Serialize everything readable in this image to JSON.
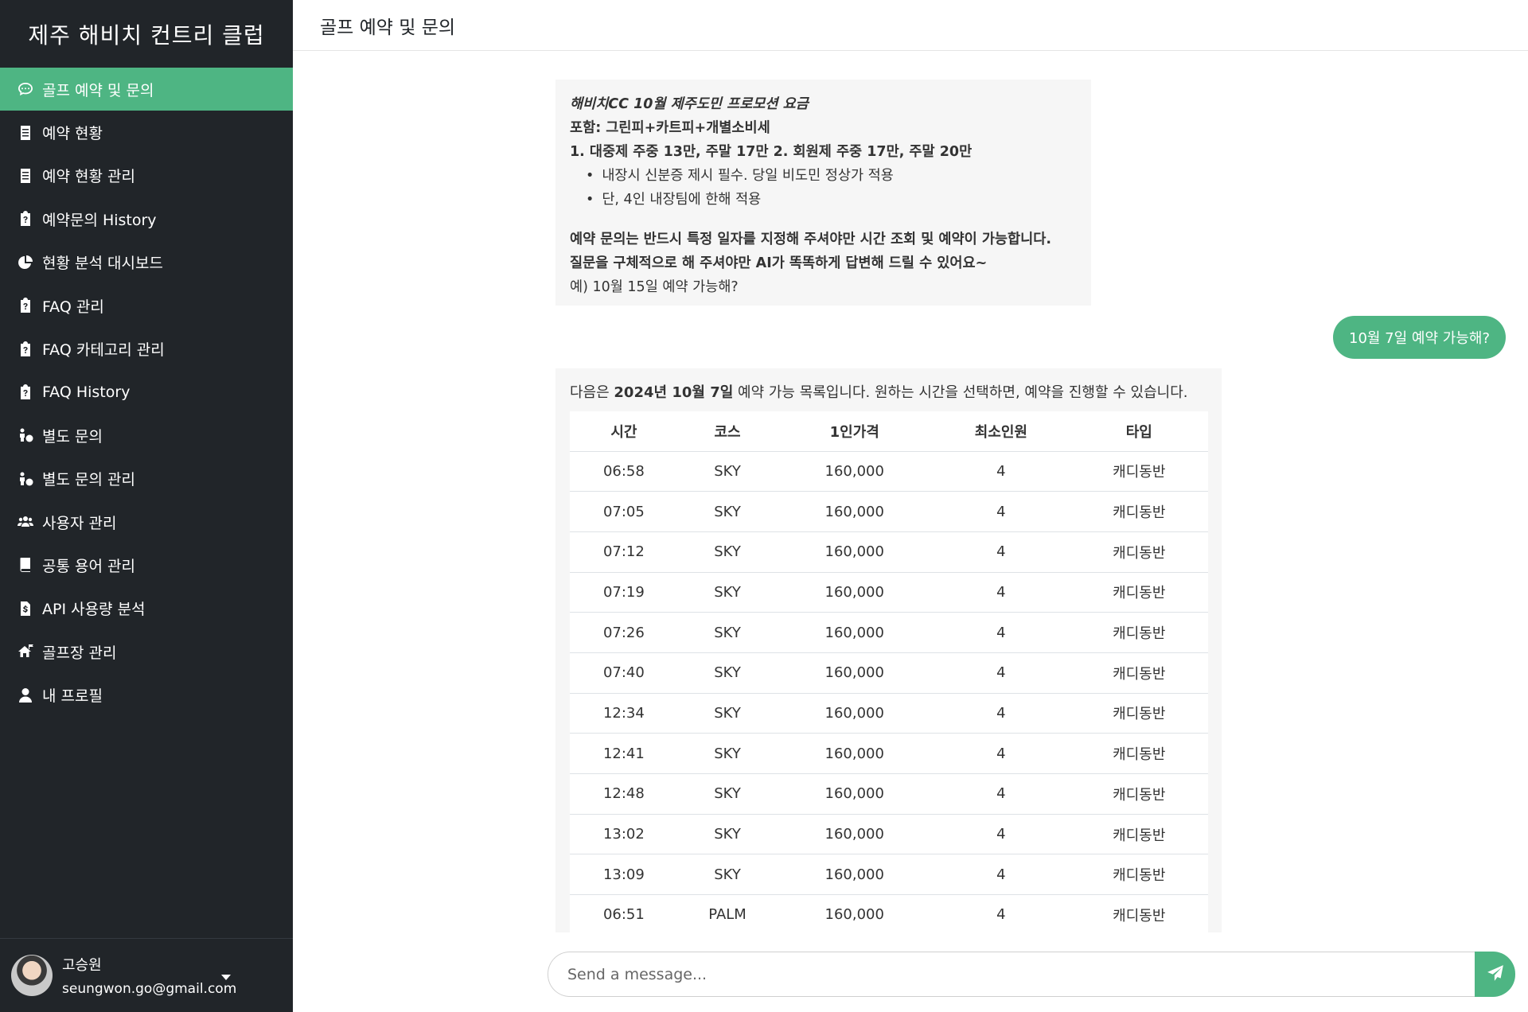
{
  "brand": "제주 해비치 컨트리 클럽",
  "header": {
    "title": "골프 예약 및 문의"
  },
  "sidebar": {
    "items": [
      {
        "label": "골프 예약 및 문의",
        "icon": "chat-icon",
        "active": true
      },
      {
        "label": "예약 현황",
        "icon": "list-icon"
      },
      {
        "label": "예약 현황 관리",
        "icon": "list-icon"
      },
      {
        "label": "예약문의 History",
        "icon": "clipboard-question-icon"
      },
      {
        "label": "현황 분석 대시보드",
        "icon": "pie-chart-icon"
      },
      {
        "label": "FAQ 관리",
        "icon": "clipboard-question-icon"
      },
      {
        "label": "FAQ 카테고리 관리",
        "icon": "clipboard-question-icon"
      },
      {
        "label": "FAQ History",
        "icon": "clipboard-question-icon"
      },
      {
        "label": "별도 문의",
        "icon": "person-question-icon"
      },
      {
        "label": "별도 문의 관리",
        "icon": "person-question-icon"
      },
      {
        "label": "사용자 관리",
        "icon": "users-icon"
      },
      {
        "label": "공통 용어 관리",
        "icon": "book-icon"
      },
      {
        "label": "API 사용량 분석",
        "icon": "dollar-file-icon"
      },
      {
        "label": "골프장 관리",
        "icon": "house-flag-icon"
      },
      {
        "label": "내 프로필",
        "icon": "user-icon"
      }
    ]
  },
  "user": {
    "name": "고승원",
    "email": "seungwon.go@gmail.com"
  },
  "messages": {
    "promo": {
      "title": "해비치CC 10월 제주도민 프로모션 요금",
      "includes": "포함: 그린피+카트피+개별소비세",
      "prices": "1. 대중제 주중 13만, 주말 17만 2. 회원제 주중 17만, 주말 20만",
      "bullets": [
        "내장시 신분증 제시 필수. 당일 비도민 정상가 적용",
        "단, 4인 내장팀에 한해 적용"
      ],
      "notice1": "예약 문의는 반드시 특정 일자를 지정해 주셔야만 시간 조회 및 예약이 가능합니다.",
      "notice2": "질문을 구체적으로 해 주셔야만 AI가 똑똑하게 답변해 드릴 수 있어요~",
      "example": "예) 10월 15일 예약 가능해?"
    },
    "user_question": "10월 7일 예약 가능해?",
    "answer": {
      "prefix": "다음은 ",
      "date": "2024년 10월 7일",
      "suffix": " 예약 가능 목록입니다. 원하는 시간을 선택하면, 예약을 진행할 수 있습니다.",
      "columns": [
        "시간",
        "코스",
        "1인가격",
        "최소인원",
        "타입"
      ],
      "rows": [
        [
          "06:58",
          "SKY",
          "160,000",
          "4",
          "캐디동반"
        ],
        [
          "07:05",
          "SKY",
          "160,000",
          "4",
          "캐디동반"
        ],
        [
          "07:12",
          "SKY",
          "160,000",
          "4",
          "캐디동반"
        ],
        [
          "07:19",
          "SKY",
          "160,000",
          "4",
          "캐디동반"
        ],
        [
          "07:26",
          "SKY",
          "160,000",
          "4",
          "캐디동반"
        ],
        [
          "07:40",
          "SKY",
          "160,000",
          "4",
          "캐디동반"
        ],
        [
          "12:34",
          "SKY",
          "160,000",
          "4",
          "캐디동반"
        ],
        [
          "12:41",
          "SKY",
          "160,000",
          "4",
          "캐디동반"
        ],
        [
          "12:48",
          "SKY",
          "160,000",
          "4",
          "캐디동반"
        ],
        [
          "13:02",
          "SKY",
          "160,000",
          "4",
          "캐디동반"
        ],
        [
          "13:09",
          "SKY",
          "160,000",
          "4",
          "캐디동반"
        ],
        [
          "06:51",
          "PALM",
          "160,000",
          "4",
          "캐디동반"
        ]
      ]
    }
  },
  "input": {
    "placeholder": "Send a message...",
    "send_icon": "paper-plane-icon"
  },
  "colors": {
    "accent": "#4eb583",
    "sidebar_bg": "#212529",
    "bubble_bg": "#f6f6f6"
  }
}
